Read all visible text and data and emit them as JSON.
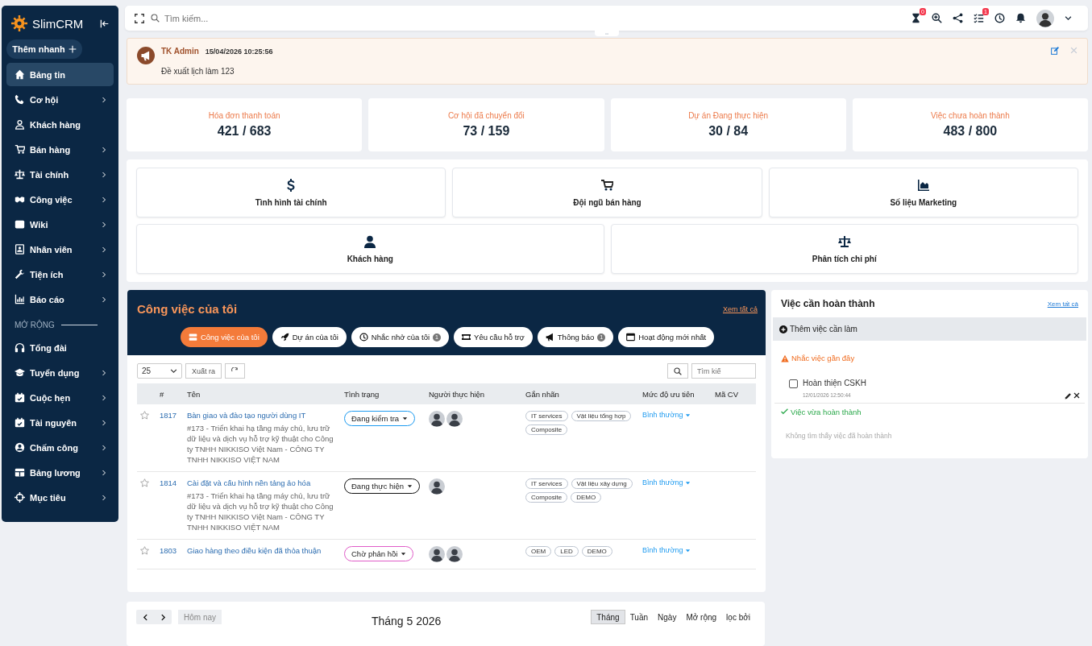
{
  "sidebar": {
    "logo": "SlimCRM",
    "quick_add": "Thêm nhanh",
    "items": [
      {
        "label": "Bảng tin",
        "selected": true,
        "submenu": false
      },
      {
        "label": "Cơ hội",
        "selected": false,
        "submenu": true
      },
      {
        "label": "Khách hàng",
        "selected": false,
        "submenu": false
      },
      {
        "label": "Bán hàng",
        "selected": false,
        "submenu": true
      },
      {
        "label": "Tài chính",
        "selected": false,
        "submenu": true
      },
      {
        "label": "Công việc",
        "selected": false,
        "submenu": true
      },
      {
        "label": "Wiki",
        "selected": false,
        "submenu": true
      },
      {
        "label": "Nhân viên",
        "selected": false,
        "submenu": true
      },
      {
        "label": "Tiện ích",
        "selected": false,
        "submenu": true
      },
      {
        "label": "Báo cáo",
        "selected": false,
        "submenu": true
      }
    ],
    "section": "MỞ RỘNG",
    "extra_items": [
      {
        "label": "Tổng đài",
        "selected": false,
        "submenu": false
      },
      {
        "label": "Tuyển dụng",
        "selected": false,
        "submenu": true
      },
      {
        "label": "Cuộc hẹn",
        "selected": false,
        "submenu": true
      },
      {
        "label": "Tài nguyên",
        "selected": false,
        "submenu": true
      },
      {
        "label": "Chấm công",
        "selected": false,
        "submenu": true
      },
      {
        "label": "Bảng lương",
        "selected": false,
        "submenu": true
      },
      {
        "label": "Mục tiêu",
        "selected": false,
        "submenu": true
      }
    ]
  },
  "topbar": {
    "search": {
      "placeholder": "Tìm kiếm..."
    },
    "timer_badge": "0",
    "tasks_badge": "1"
  },
  "notice": {
    "author": "TK Admin",
    "time": "15/04/2026 10:25:56",
    "message": "Đề xuất lịch làm 123"
  },
  "stats": [
    {
      "label": "Hóa đơn thanh toán",
      "value": "421 / 683"
    },
    {
      "label": "Cơ hội đã chuyển đổi",
      "value": "73 / 159"
    },
    {
      "label": "Dự án Đang thực hiện",
      "value": "30 / 84"
    },
    {
      "label": "Việc chưa hoàn thành",
      "value": "483 / 800"
    }
  ],
  "shortcuts": [
    "Tình hình tài chính",
    "Đội ngũ bán hàng",
    "Số liệu Marketing",
    "Khách hàng",
    "Phân tích chi phí"
  ],
  "my_work": {
    "title": "Công việc của tôi",
    "view_all": "Xem tất cả",
    "tabs": [
      {
        "label": "Công việc của tôi",
        "selected": true
      },
      {
        "label": "Dự án của tôi",
        "selected": false
      },
      {
        "label": "Nhắc nhở của tôi",
        "selected": false,
        "count": "1"
      },
      {
        "label": "Yêu cầu hỗ trợ",
        "selected": false
      },
      {
        "label": "Thông báo",
        "selected": false,
        "count": "1"
      },
      {
        "label": "Hoạt động mới nhất",
        "selected": false
      }
    ],
    "page_size": "25",
    "export": "Xuất ra",
    "search": {
      "placeholder": "Tìm kiế"
    },
    "columns": [
      "#",
      "Tên",
      "Tình trạng",
      "Người thực hiện",
      "Gắn nhãn",
      "Mức độ ưu tiên",
      "Mã CV"
    ],
    "rows": [
      {
        "id": "1817",
        "title": "Bàn giao và đào tạo người dùng IT",
        "description": "#173 - Triển khai hạ tầng máy chủ, lưu trữ dữ liệu và dịch vụ hỗ trợ kỹ thuật cho Công ty TNHH NIKKISO Việt Nam - CÔNG TY TNHH NIKKISO VIỆT NAM",
        "status": {
          "label": "Đang kiểm tra",
          "color": "#1e9bf0"
        },
        "assignees": [
          {
            "kind": "avatar"
          },
          {
            "kind": "avatar"
          }
        ],
        "tags": [
          "IT services",
          "Vật liệu tổng hợp",
          "Composite"
        ],
        "priority": "Bình thường"
      },
      {
        "id": "1814",
        "title": "Cài đặt và cấu hình nền tảng ảo hóa",
        "description": "#173 - Triển khai hạ tầng máy chủ, lưu trữ dữ liệu và dịch vụ hỗ trợ kỹ thuật cho Công ty TNHH NIKKISO Việt Nam - CÔNG TY TNHH NIKKISO VIỆT NAM",
        "status": {
          "label": "Đang thực hiện",
          "color": "#111111"
        },
        "assignees": [
          {
            "kind": "avatar"
          }
        ],
        "tags": [
          "IT services",
          "Vật liệu xây dựng",
          "Composite",
          "DEMO"
        ],
        "priority": "Bình thường"
      },
      {
        "id": "1803",
        "title": "Giao hàng theo điều kiện đã thỏa thuận",
        "status": {
          "label": "Chờ phản hồi",
          "color": "#e05cc8"
        },
        "assignees": [
          {
            "kind": "avatar"
          },
          {
            "kind": "avatar"
          }
        ],
        "tags": [
          "OEM",
          "LED",
          "DEMO"
        ],
        "priority": "Bình thường"
      }
    ]
  },
  "todo": {
    "title": "Việc cần hoàn thành",
    "view_all": "Xem tất cả",
    "add": "Thêm việc cần làm",
    "reminders_heading": "Nhắc việc gần đây",
    "items": [
      {
        "label": "Hoàn thiện CSKH",
        "time": "12/01/2026 12:50:44",
        "checked": false
      }
    ],
    "done_heading": "Việc vừa hoàn thành",
    "done_empty": "Không tìm thấy việc đã hoàn thành"
  },
  "calendar": {
    "today": "Hôm nay",
    "title": "Tháng 5 2026",
    "views": [
      {
        "label": "Tháng",
        "selected": true
      },
      {
        "label": "Tuần",
        "selected": false
      },
      {
        "label": "Ngày",
        "selected": false
      },
      {
        "label": "Mở rộng",
        "selected": false
      },
      {
        "label": "lọc bởi",
        "selected": false
      }
    ]
  }
}
